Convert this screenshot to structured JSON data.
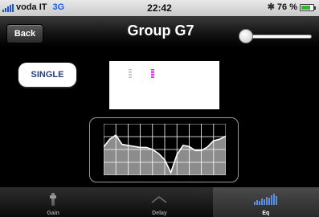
{
  "status_bar": {
    "carrier": "voda IT",
    "network": "3G",
    "time": "22:42",
    "battery": "76 %",
    "battery_level": 0.76,
    "icons": [
      "signal-icon",
      "bluetooth-icon",
      "battery-icon"
    ]
  },
  "nav_bar": {
    "back_label": "Back",
    "title": "Group G7",
    "slider_level": 0.05
  },
  "content": {
    "mode_button_label": "SINGLE",
    "meter_colors": [
      "#bbbbbb",
      "#e11ee6"
    ]
  },
  "tabs": [
    {
      "label": "Gain",
      "icon": "fader-icon",
      "active": false
    },
    {
      "label": "Delay",
      "icon": "delay-chevron-icon",
      "active": false
    },
    {
      "label": "Eq",
      "icon": "eq-bars-icon",
      "active": true
    }
  ],
  "eq_curve": {
    "grid_columns": 10,
    "grid_rows": 4,
    "points": [
      0.45,
      0.3,
      0.22,
      0.4,
      0.42,
      0.44,
      0.46,
      0.46,
      0.5,
      0.58,
      0.7,
      0.95,
      0.6,
      0.42,
      0.44,
      0.52,
      0.52,
      0.45,
      0.33,
      0.3,
      0.24
    ]
  },
  "colors": {
    "accent_blue": "#1e5fd6",
    "meter_pink": "#e11ee6",
    "button_text": "#2a3f82"
  }
}
